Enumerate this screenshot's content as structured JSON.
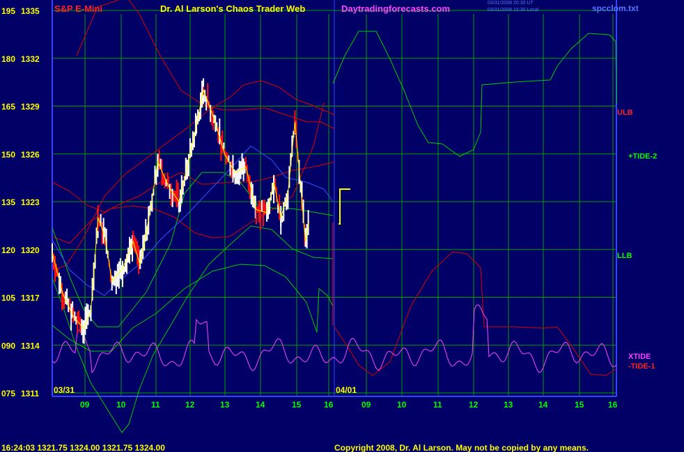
{
  "header": {
    "instrument": "S&P E-Mini",
    "publisher": "Dr. Al Larson's Chaos Trader Web",
    "website": "Daytradingforecasts.com",
    "timestamp_line1": "03/31/2008 20:30 UT",
    "timestamp_line2": "03/31/2008 15:30 Local",
    "data_file": "spcclom.txt"
  },
  "footer": {
    "quote": "16:24:03  1321.75 1324.00 1321.75 1324.00",
    "copyright": "Copyright 2008, Dr. Al Larson. May not be copied by any means."
  },
  "date_labels": {
    "left": "03/31",
    "right": "04/01"
  },
  "right_labels": {
    "ulb": "ULB",
    "tide2": "+TIDE-2",
    "llb": "LLB",
    "xtide": "XTIDE",
    "tide1": "-TIDE-1"
  },
  "colors": {
    "background": "#000066",
    "grid": "#00a000",
    "axis": "#3344ff",
    "price_bars": "#ffffff",
    "price_bars_down": "#ff1111",
    "band_lines": "#dd0000",
    "tide_line": "#00cc00",
    "xtide_line": "#ff44ff",
    "average_line": "#ffff00",
    "blue_line": "#3355ff"
  },
  "chart_data": {
    "type": "line",
    "y_axis_left_labels": [
      "195",
      "180",
      "165",
      "150",
      "135",
      "120",
      "105",
      "090",
      "075"
    ],
    "y_axis_price_labels": [
      "1335",
      "1332",
      "1329",
      "1326",
      "1323",
      "1320",
      "1317",
      "1314",
      "1311"
    ],
    "ylim": [
      1311,
      1335
    ],
    "x_tick_labels": [
      "09",
      "10",
      "11",
      "12",
      "13",
      "14",
      "15",
      "16",
      "09",
      "10",
      "11",
      "12",
      "13",
      "14",
      "15",
      "16"
    ],
    "price_series_approx": [
      [
        0.0,
        1319.8
      ],
      [
        0.3,
        1317.2
      ],
      [
        0.6,
        1315.8
      ],
      [
        0.9,
        1315.0
      ],
      [
        1.1,
        1316.2
      ],
      [
        1.3,
        1322.0
      ],
      [
        1.5,
        1320.8
      ],
      [
        1.7,
        1318.0
      ],
      [
        2.0,
        1318.8
      ],
      [
        2.3,
        1320.5
      ],
      [
        2.5,
        1319.0
      ],
      [
        2.8,
        1322.6
      ],
      [
        3.0,
        1325.5
      ],
      [
        3.3,
        1324.0
      ],
      [
        3.6,
        1323.0
      ],
      [
        3.8,
        1324.8
      ],
      [
        4.1,
        1327.8
      ],
      [
        4.3,
        1330.0
      ],
      [
        4.6,
        1328.2
      ],
      [
        4.9,
        1326.0
      ],
      [
        5.2,
        1324.8
      ],
      [
        5.5,
        1325.2
      ],
      [
        5.8,
        1322.5
      ],
      [
        6.1,
        1322.3
      ],
      [
        6.3,
        1324.2
      ],
      [
        6.5,
        1322.0
      ],
      [
        6.7,
        1323.5
      ],
      [
        6.9,
        1328.0
      ],
      [
        7.1,
        1323.0
      ],
      [
        7.2,
        1320.5
      ],
      [
        7.3,
        1321.75
      ]
    ]
  }
}
